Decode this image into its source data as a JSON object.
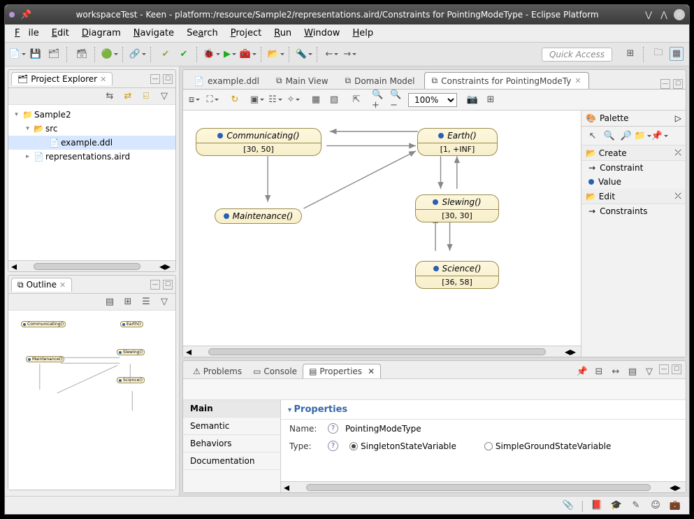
{
  "titlebar": {
    "title": "workspaceTest - Keen - platform:/resource/Sample2/representations.aird/Constraints for PointingModeType - Eclipse Platform"
  },
  "menu": {
    "file": "File",
    "edit": "Edit",
    "diagram": "Diagram",
    "navigate": "Navigate",
    "search": "Search",
    "project": "Project",
    "run": "Run",
    "window": "Window",
    "help": "Help"
  },
  "toolbar": {
    "quick_access_placeholder": "Quick Access"
  },
  "project_explorer": {
    "title": "Project Explorer",
    "items": {
      "root": "Sample2",
      "src": "src",
      "file1": "example.ddl",
      "file2": "representations.aird"
    }
  },
  "outline": {
    "title": "Outline"
  },
  "editor": {
    "tabs": {
      "t0": "example.ddl",
      "t1": "Main View",
      "t2": "Domain Model",
      "t3": "Constraints for PointingModeTy"
    },
    "zoom": "100%"
  },
  "nodes": {
    "communicating": {
      "label": "Communicating()",
      "range": "[30, 50]"
    },
    "earth": {
      "label": "Earth()",
      "range": "[1, +INF]"
    },
    "slewing": {
      "label": "Slewing()",
      "range": "[30, 30]"
    },
    "maintenance": {
      "label": "Maintenance()",
      "range": ""
    },
    "science": {
      "label": "Science()",
      "range": "[36, 58]"
    }
  },
  "palette": {
    "title": "Palette",
    "create": "Create",
    "constraint": "Constraint",
    "value": "Value",
    "edit": "Edit",
    "constraints": "Constraints"
  },
  "lower": {
    "tabs": {
      "problems": "Problems",
      "console": "Console",
      "properties": "Properties"
    },
    "nav": {
      "main": "Main",
      "semantic": "Semantic",
      "behaviors": "Behaviors",
      "documentation": "Documentation"
    },
    "section_title": "Properties",
    "name_label": "Name:",
    "name_value": "PointingModeType",
    "type_label": "Type:",
    "type_opt1": "SingletonStateVariable",
    "type_opt2": "SimpleGroundStateVariable"
  },
  "chart_data": {
    "type": "diagram",
    "nodes": [
      {
        "id": "Communicating",
        "range": [
          30,
          50
        ]
      },
      {
        "id": "Earth",
        "range": [
          1,
          null
        ]
      },
      {
        "id": "Slewing",
        "range": [
          30,
          30
        ]
      },
      {
        "id": "Maintenance",
        "range": null
      },
      {
        "id": "Science",
        "range": [
          36,
          58
        ]
      }
    ],
    "edges": [
      {
        "from": "Earth",
        "to": "Communicating"
      },
      {
        "from": "Communicating",
        "to": "Earth"
      },
      {
        "from": "Communicating",
        "to": "Maintenance"
      },
      {
        "from": "Maintenance",
        "to": "Earth"
      },
      {
        "from": "Earth",
        "to": "Slewing"
      },
      {
        "from": "Slewing",
        "to": "Earth"
      },
      {
        "from": "Slewing",
        "to": "Science"
      },
      {
        "from": "Science",
        "to": "Slewing"
      }
    ]
  }
}
